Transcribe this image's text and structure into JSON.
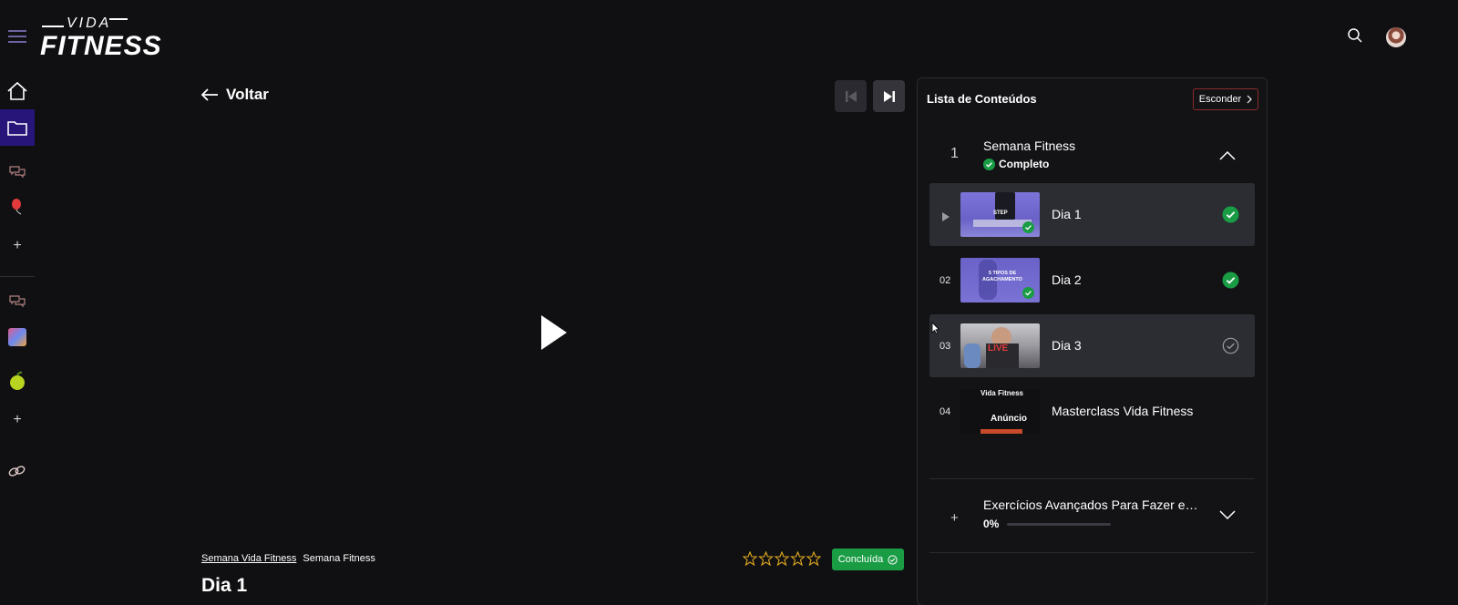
{
  "brand": {
    "logo_top": "VIDA",
    "logo_bottom": "FITNESS"
  },
  "nav": {
    "back_label": "Voltar"
  },
  "panel": {
    "title": "Lista de Conteúdos",
    "hide_label": "Esconder",
    "module1": {
      "number": "1",
      "name": "Semana Fitness",
      "status": "Completo",
      "lessons": [
        {
          "index": "",
          "name": "Dia 1",
          "thumb_text": "STEP",
          "completed": true,
          "current": true
        },
        {
          "index": "02",
          "name": "Dia 2",
          "thumb_text": "5 TIPOS DE AGACHAMENTO",
          "completed": true,
          "current": false
        },
        {
          "index": "03",
          "name": "Dia 3",
          "thumb_text": "LIVE",
          "completed": false,
          "current": false
        },
        {
          "index": "04",
          "name": "Masterclass Vida Fitness",
          "thumb_text_top": "Vida Fitness",
          "thumb_text": "Anúncio",
          "completed": false,
          "current": false
        }
      ]
    },
    "module2": {
      "name": "Exercícios Avançados Para Fazer em...",
      "progress_label": "0%",
      "progress": 0
    }
  },
  "player": {
    "breadcrumb_course": "Semana Vida Fitness",
    "breadcrumb_module": "Semana Fitness",
    "completed_label": "Concluída",
    "lesson_title": "Dia 1",
    "rating": 0
  },
  "colors": {
    "accent": "#27157a",
    "success": "#1a9c45",
    "background": "#101012"
  }
}
